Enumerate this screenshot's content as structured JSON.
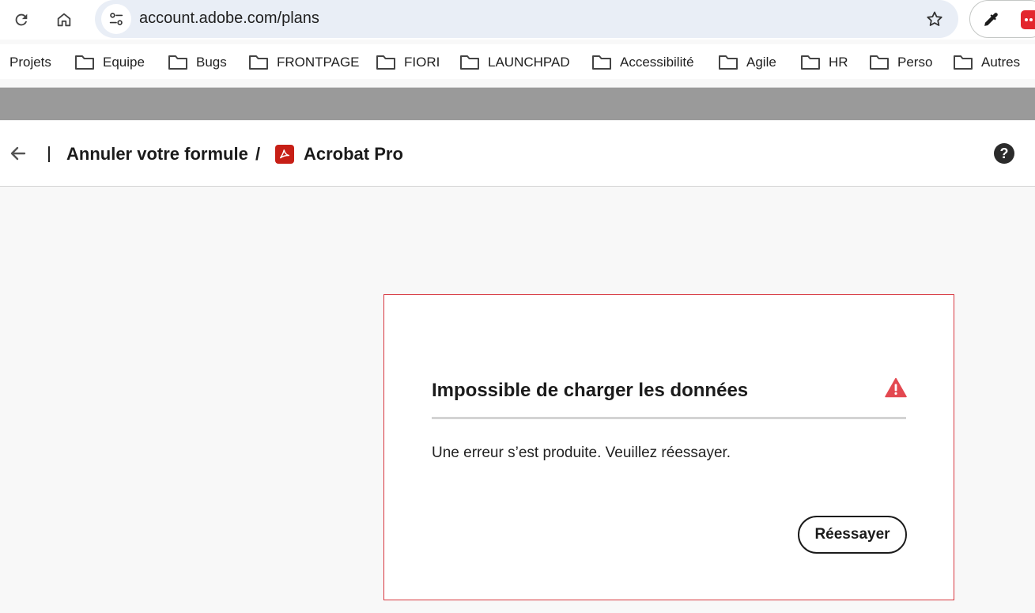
{
  "browser": {
    "url": "account.adobe.com/plans",
    "icons": {
      "reload": "reload-icon",
      "home": "home-icon",
      "site_settings": "tune-icon",
      "bookmark": "star-icon",
      "extension": "eyedropper-icon"
    }
  },
  "bookmarks": [
    {
      "label": "Projets",
      "folder": false
    },
    {
      "label": "Equipe",
      "folder": true
    },
    {
      "label": "Bugs",
      "folder": true
    },
    {
      "label": "FRONTPAGE",
      "folder": true
    },
    {
      "label": "FIORI",
      "folder": true
    },
    {
      "label": "LAUNCHPAD",
      "folder": true
    },
    {
      "label": "Accessibilité",
      "folder": true
    },
    {
      "label": "Agile",
      "folder": true
    },
    {
      "label": "HR",
      "folder": true
    },
    {
      "label": "Perso",
      "folder": true
    },
    {
      "label": "Autres",
      "folder": true
    }
  ],
  "header": {
    "back_icon": "arrow-left-icon",
    "breadcrumb_cancel": "Annuler votre formule",
    "separator": "/",
    "product_icon": "acrobat-icon",
    "product_name": "Acrobat Pro",
    "help_icon": "help-icon",
    "help_glyph": "?"
  },
  "error": {
    "title": "Impossible de charger les données",
    "icon": "alert-triangle-icon",
    "message": "Une erreur s’est produite. Veuillez réessayer.",
    "retry_label": "Réessayer"
  },
  "colors": {
    "error_border": "#d7373f",
    "alert_icon": "#e34850",
    "acrobat_red": "#c71f16",
    "omnibox_bg": "#e9eef6",
    "page_bg": "#f8f8f8",
    "band_gray": "#9a9a9a"
  }
}
